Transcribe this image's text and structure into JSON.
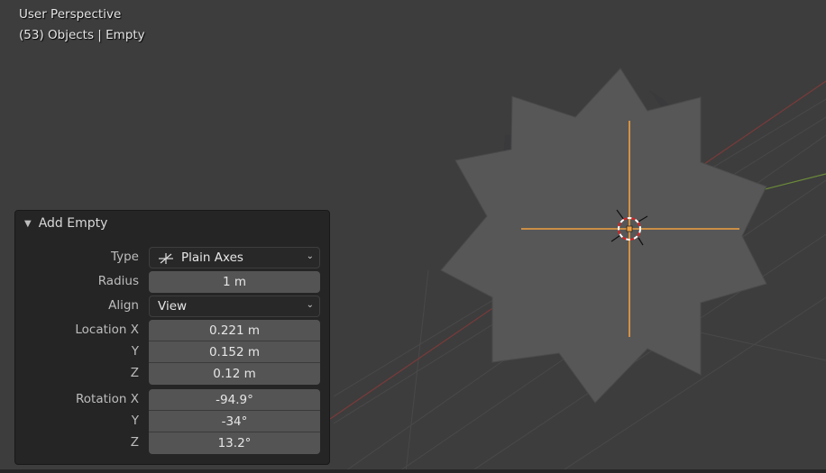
{
  "viewport": {
    "view_name": "User Perspective",
    "context_info": "(53) Objects | Empty",
    "colors": {
      "background": "#3d3d3d",
      "object_fill": "#565656",
      "selection": "#f0a040",
      "x_axis": "#8a3a3a",
      "y_axis": "#6b8a3a",
      "grid": "#4a4a4a"
    }
  },
  "operator_panel": {
    "title": "Add Empty",
    "collapse_icon": "triangle-down-icon",
    "fields": {
      "type": {
        "label": "Type",
        "value": "Plain Axes",
        "icon": "plain-axes-icon"
      },
      "radius": {
        "label": "Radius",
        "value": "1 m"
      },
      "align": {
        "label": "Align",
        "value": "View"
      },
      "location": {
        "label_x": "Location X",
        "label_y": "Y",
        "label_z": "Z",
        "x": "0.221 m",
        "y": "0.152 m",
        "z": "0.12 m"
      },
      "rotation": {
        "label_x": "Rotation X",
        "label_y": "Y",
        "label_z": "Z",
        "x": "-94.9°",
        "y": "-34°",
        "z": "13.2°"
      }
    }
  }
}
